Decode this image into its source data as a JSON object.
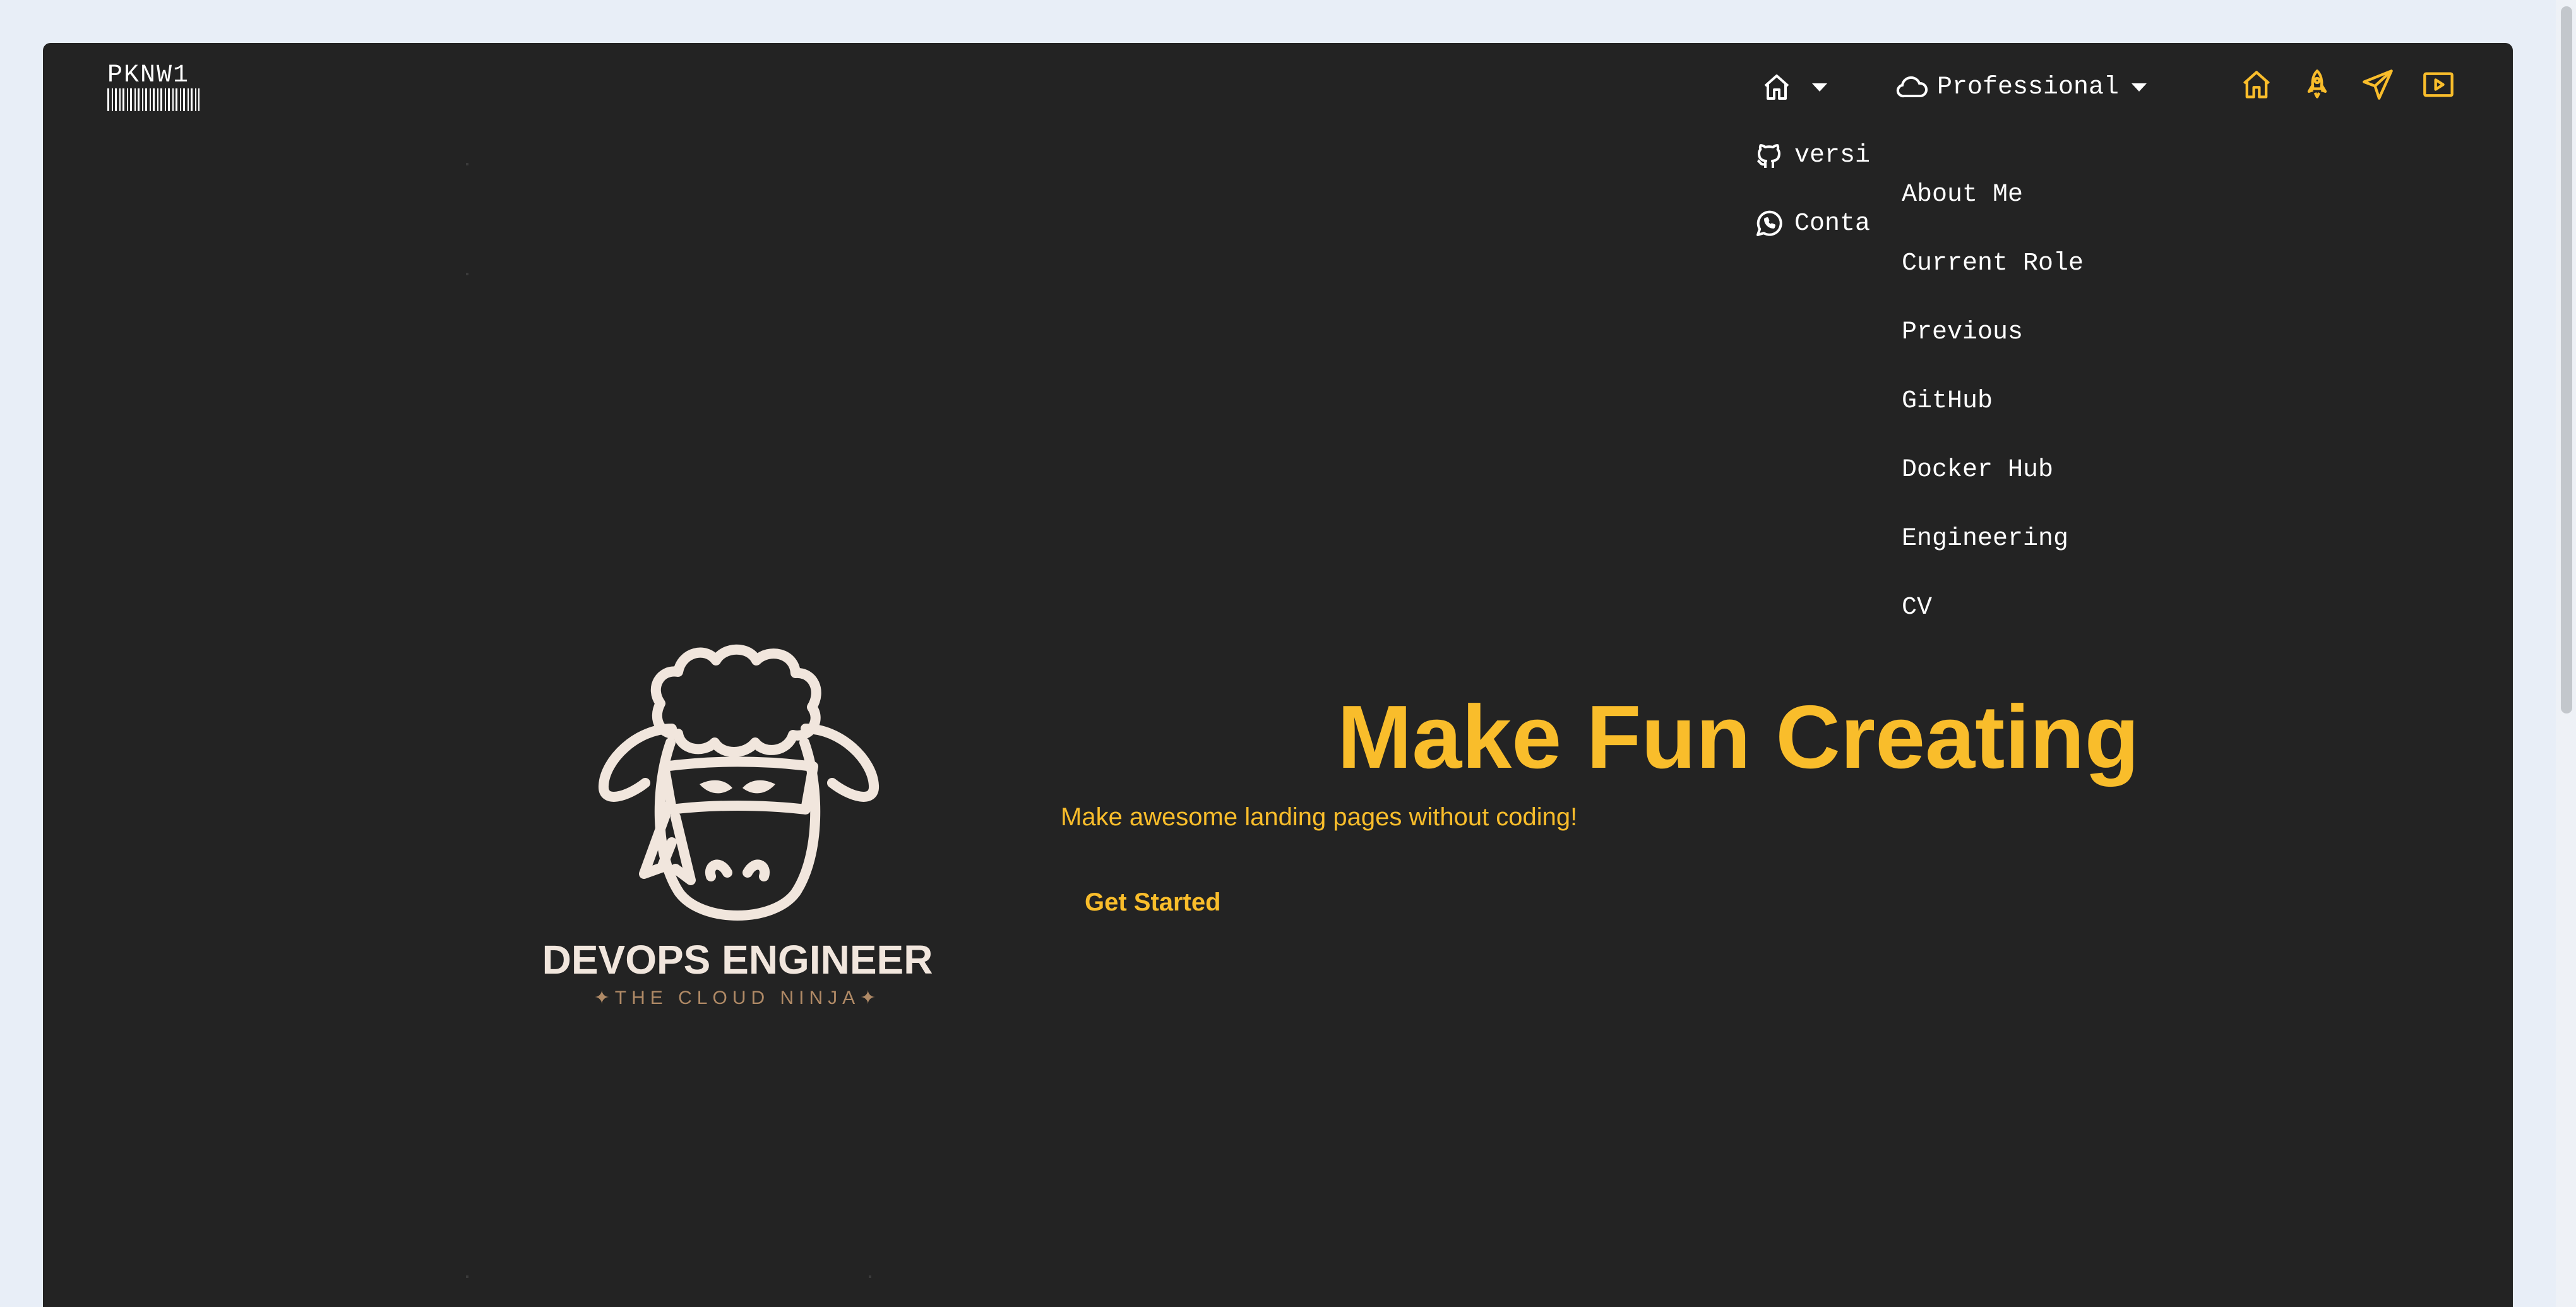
{
  "logo": {
    "text": "PKNW1"
  },
  "nav": {
    "home_icon": "home-icon",
    "professional_label": "Professional",
    "professional_icon": "cloud-icon",
    "left_items": [
      {
        "label": "versi",
        "icon": "github-icon"
      },
      {
        "label": "Conta",
        "icon": "whatsapp-icon"
      }
    ],
    "professional_items": [
      "About Me",
      "Current Role",
      "Previous",
      "GitHub",
      "Docker Hub",
      "Engineering",
      "CV"
    ],
    "quick_icons": [
      "home-icon",
      "rocket-icon",
      "send-icon",
      "video-icon"
    ]
  },
  "hero": {
    "brand_title": "DEVOPS ENGINEER",
    "brand_tagline": "✦THE CLOUD NINJA✦",
    "title": "Make Fun Creating",
    "subtitle": "Make awesome landing pages without coding!",
    "cta_label": "Get Started"
  },
  "colors": {
    "accent": "#f9bd2b",
    "background": "#232323",
    "page": "#e8eef7",
    "logo_cream": "#f1e6dd",
    "logo_tagline": "#b08a66"
  }
}
